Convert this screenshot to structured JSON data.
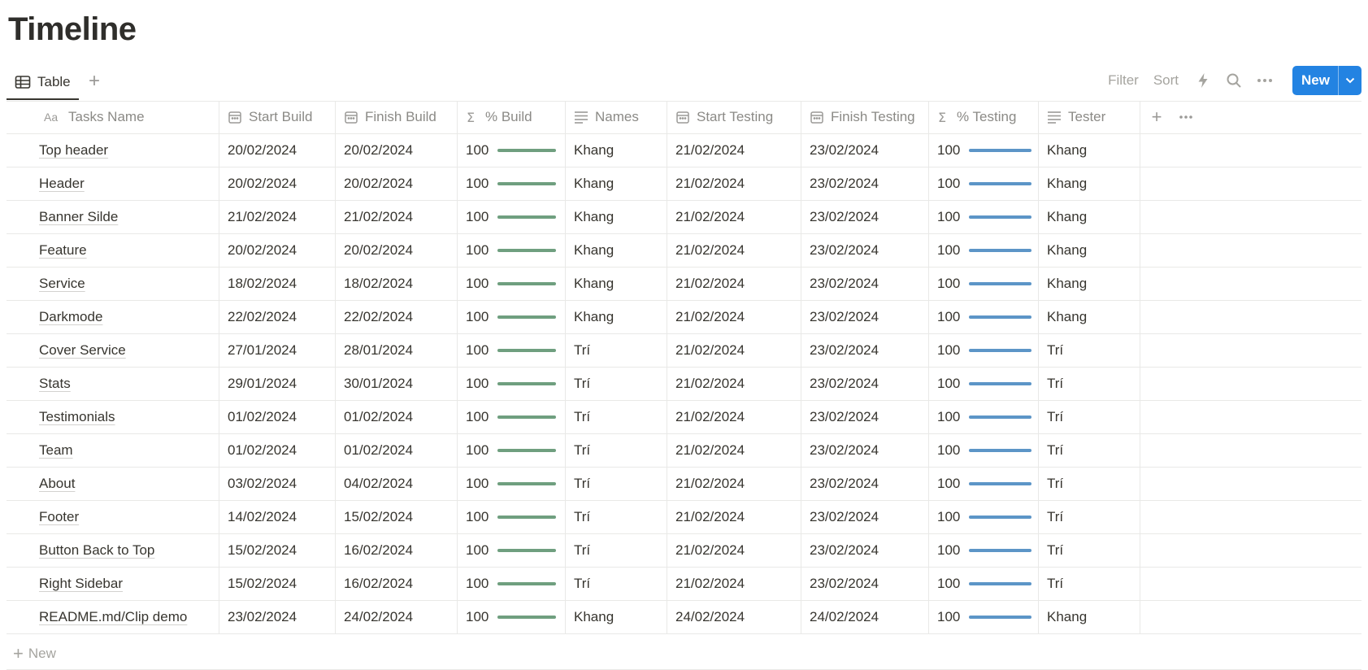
{
  "page": {
    "title": "Timeline"
  },
  "view_tabs": {
    "active_label": "Table"
  },
  "toolbar": {
    "filter_label": "Filter",
    "sort_label": "Sort",
    "new_label": "New"
  },
  "colors": {
    "accent": "#2383e2",
    "build_bar": "#6f9f7f",
    "test_bar": "#5c95c7"
  },
  "icons": {
    "table_view": "table-icon",
    "add_view": "plus-icon",
    "automation": "lightning-icon",
    "search": "search-icon",
    "more": "ellipsis-icon",
    "dropdown": "chevron-down-icon",
    "title_col": "text-aa-icon",
    "date_col": "calendar-icon",
    "formula_col": "sigma-icon",
    "text_col": "lines-icon"
  },
  "table": {
    "columns": [
      {
        "label": "Tasks Name",
        "icon": "text-aa-icon"
      },
      {
        "label": "Start Build",
        "icon": "calendar-icon"
      },
      {
        "label": "Finish Build",
        "icon": "calendar-icon"
      },
      {
        "label": "% Build",
        "icon": "sigma-icon"
      },
      {
        "label": "Names",
        "icon": "lines-icon"
      },
      {
        "label": "Start Testing",
        "icon": "calendar-icon"
      },
      {
        "label": "Finish Testing",
        "icon": "calendar-icon"
      },
      {
        "label": "% Testing",
        "icon": "sigma-icon"
      },
      {
        "label": "Tester",
        "icon": "lines-icon"
      }
    ],
    "rows": [
      {
        "task": "Top header",
        "start_build": "20/02/2024",
        "finish_build": "20/02/2024",
        "pct_build": "100",
        "names": "Khang",
        "start_testing": "21/02/2024",
        "finish_testing": "23/02/2024",
        "pct_testing": "100",
        "tester": "Khang"
      },
      {
        "task": "Header",
        "start_build": "20/02/2024",
        "finish_build": "20/02/2024",
        "pct_build": "100",
        "names": "Khang",
        "start_testing": "21/02/2024",
        "finish_testing": "23/02/2024",
        "pct_testing": "100",
        "tester": "Khang"
      },
      {
        "task": "Banner Silde",
        "start_build": "21/02/2024",
        "finish_build": "21/02/2024",
        "pct_build": "100",
        "names": "Khang",
        "start_testing": "21/02/2024",
        "finish_testing": "23/02/2024",
        "pct_testing": "100",
        "tester": "Khang"
      },
      {
        "task": "Feature",
        "start_build": "20/02/2024",
        "finish_build": "20/02/2024",
        "pct_build": "100",
        "names": "Khang",
        "start_testing": "21/02/2024",
        "finish_testing": "23/02/2024",
        "pct_testing": "100",
        "tester": "Khang"
      },
      {
        "task": "Service",
        "start_build": "18/02/2024",
        "finish_build": "18/02/2024",
        "pct_build": "100",
        "names": "Khang",
        "start_testing": "21/02/2024",
        "finish_testing": "23/02/2024",
        "pct_testing": "100",
        "tester": "Khang"
      },
      {
        "task": "Darkmode",
        "start_build": "22/02/2024",
        "finish_build": "22/02/2024",
        "pct_build": "100",
        "names": "Khang",
        "start_testing": "21/02/2024",
        "finish_testing": "23/02/2024",
        "pct_testing": "100",
        "tester": "Khang"
      },
      {
        "task": "Cover Service",
        "start_build": "27/01/2024",
        "finish_build": "28/01/2024",
        "pct_build": "100",
        "names": "Trí",
        "start_testing": "21/02/2024",
        "finish_testing": "23/02/2024",
        "pct_testing": "100",
        "tester": "Trí"
      },
      {
        "task": "Stats",
        "start_build": "29/01/2024",
        "finish_build": "30/01/2024",
        "pct_build": "100",
        "names": "Trí",
        "start_testing": "21/02/2024",
        "finish_testing": "23/02/2024",
        "pct_testing": "100",
        "tester": "Trí"
      },
      {
        "task": "Testimonials",
        "start_build": "01/02/2024",
        "finish_build": "01/02/2024",
        "pct_build": "100",
        "names": "Trí",
        "start_testing": "21/02/2024",
        "finish_testing": "23/02/2024",
        "pct_testing": "100",
        "tester": "Trí"
      },
      {
        "task": "Team",
        "start_build": "01/02/2024",
        "finish_build": "01/02/2024",
        "pct_build": "100",
        "names": "Trí",
        "start_testing": "21/02/2024",
        "finish_testing": "23/02/2024",
        "pct_testing": "100",
        "tester": "Trí"
      },
      {
        "task": "About",
        "start_build": "03/02/2024",
        "finish_build": "04/02/2024",
        "pct_build": "100",
        "names": "Trí",
        "start_testing": "21/02/2024",
        "finish_testing": "23/02/2024",
        "pct_testing": "100",
        "tester": "Trí"
      },
      {
        "task": "Footer",
        "start_build": "14/02/2024",
        "finish_build": "15/02/2024",
        "pct_build": "100",
        "names": "Trí",
        "start_testing": "21/02/2024",
        "finish_testing": "23/02/2024",
        "pct_testing": "100",
        "tester": "Trí"
      },
      {
        "task": "Button Back to Top",
        "start_build": "15/02/2024",
        "finish_build": "16/02/2024",
        "pct_build": "100",
        "names": "Trí",
        "start_testing": "21/02/2024",
        "finish_testing": "23/02/2024",
        "pct_testing": "100",
        "tester": "Trí"
      },
      {
        "task": "Right Sidebar",
        "start_build": "15/02/2024",
        "finish_build": "16/02/2024",
        "pct_build": "100",
        "names": "Trí",
        "start_testing": "21/02/2024",
        "finish_testing": "23/02/2024",
        "pct_testing": "100",
        "tester": "Trí"
      },
      {
        "task": "README.md/Clip demo",
        "start_build": "23/02/2024",
        "finish_build": "24/02/2024",
        "pct_build": "100",
        "names": "Khang",
        "start_testing": "24/02/2024",
        "finish_testing": "24/02/2024",
        "pct_testing": "100",
        "tester": "Khang"
      }
    ],
    "new_row_label": "New"
  }
}
